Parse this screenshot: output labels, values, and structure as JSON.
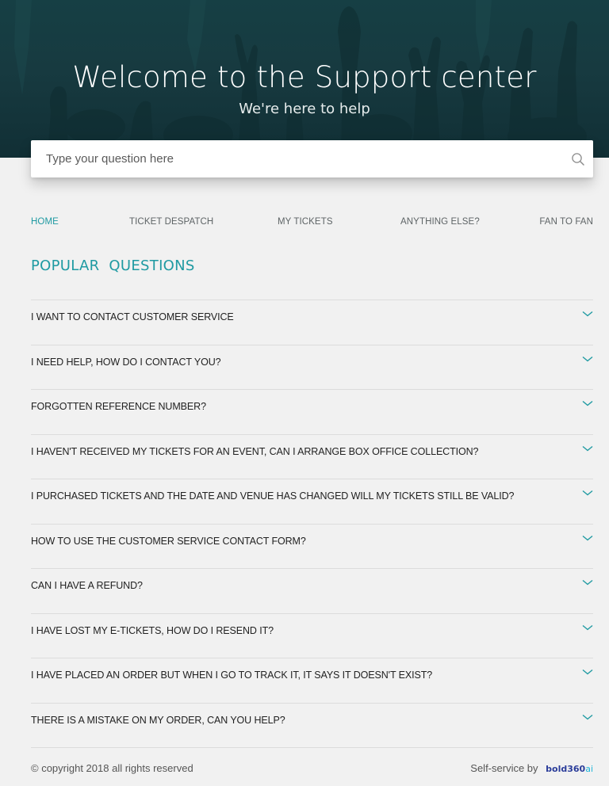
{
  "hero": {
    "title": "Welcome to the Support center",
    "subtitle": "We're here to help"
  },
  "search": {
    "placeholder": "Type your question here",
    "icon": "search-icon"
  },
  "nav": {
    "items": [
      {
        "label": "HOME",
        "active": true
      },
      {
        "label": "TICKET DESPATCH",
        "active": false
      },
      {
        "label": "MY TICKETS",
        "active": false
      },
      {
        "label": "ANYTHING ELSE?",
        "active": false
      },
      {
        "label": "FAN TO FAN",
        "active": false
      }
    ]
  },
  "popular": {
    "title": "POPULAR QUESTIONS",
    "questions": [
      "I WANT TO CONTACT CUSTOMER SERVICE",
      "I NEED HELP, HOW DO I CONTACT YOU?",
      "FORGOTTEN REFERENCE NUMBER?",
      "I HAVEN'T RECEIVED MY TICKETS FOR AN EVENT, CAN I ARRANGE BOX OFFICE COLLECTION?",
      "I PURCHASED TICKETS AND THE DATE AND VENUE HAS CHANGED WILL MY TICKETS STILL BE VALID?",
      "HOW TO USE THE CUSTOMER SERVICE CONTACT FORM?",
      "CAN I HAVE A REFUND?",
      "I HAVE LOST MY E-TICKETS, HOW DO I RESEND IT?",
      "I HAVE PLACED AN ORDER BUT WHEN I GO TO TRACK IT, IT SAYS IT DOESN'T EXIST?",
      "THERE IS A MISTAKE ON MY ORDER, CAN YOU HELP?"
    ]
  },
  "footer": {
    "copyright": "© copyright 2018 all rights reserved",
    "powered_label": "Self-service by",
    "brand_name": "bold360",
    "brand_suffix": "ai"
  },
  "colors": {
    "accent": "#1f9aa2",
    "hero_bg": "#163f44",
    "page_bg": "#f1f1f1"
  }
}
